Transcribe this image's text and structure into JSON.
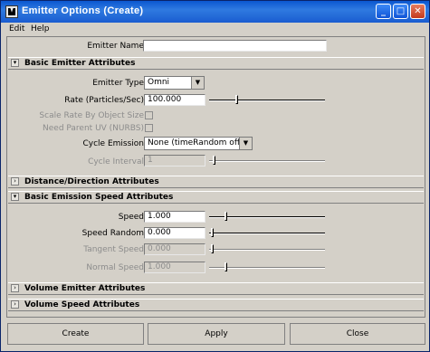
{
  "window": {
    "title": "Emitter Options (Create)"
  },
  "menu": {
    "edit": "Edit",
    "help": "Help"
  },
  "emitter_name": {
    "label": "Emitter Name",
    "value": ""
  },
  "sections": {
    "basic_emitter": "Basic Emitter Attributes",
    "distance": "Distance/Direction Attributes",
    "basic_speed": "Basic Emission Speed Attributes",
    "volume_emitter": "Volume Emitter Attributes",
    "volume_speed": "Volume Speed Attributes"
  },
  "basic": {
    "emitter_type_label": "Emitter Type",
    "emitter_type_value": "Omni",
    "rate_label": "Rate (Particles/Sec)",
    "rate_value": "100.000",
    "rate_slider": 0.22,
    "scale_rate_label": "Scale Rate By Object Size",
    "need_parent_label": "Need Parent UV (NURBS)",
    "cycle_label": "Cycle Emission",
    "cycle_value": "None (timeRandom off)",
    "cycle_interval_label": "Cycle Interval",
    "cycle_interval_value": "1",
    "cycle_slider": 0.02
  },
  "speed": {
    "speed_label": "Speed",
    "speed_value": "1.000",
    "speed_slider": 0.12,
    "random_label": "Speed Random",
    "random_value": "0.000",
    "random_slider": 0.0,
    "tangent_label": "Tangent Speed",
    "tangent_value": "0.000",
    "tangent_slider": 0.0,
    "normal_label": "Normal Speed",
    "normal_value": "1.000",
    "normal_slider": 0.12
  },
  "buttons": {
    "create": "Create",
    "apply": "Apply",
    "close": "Close"
  },
  "colors": {
    "titlebar": "#0b57d0",
    "panel": "#d4d0c8"
  }
}
